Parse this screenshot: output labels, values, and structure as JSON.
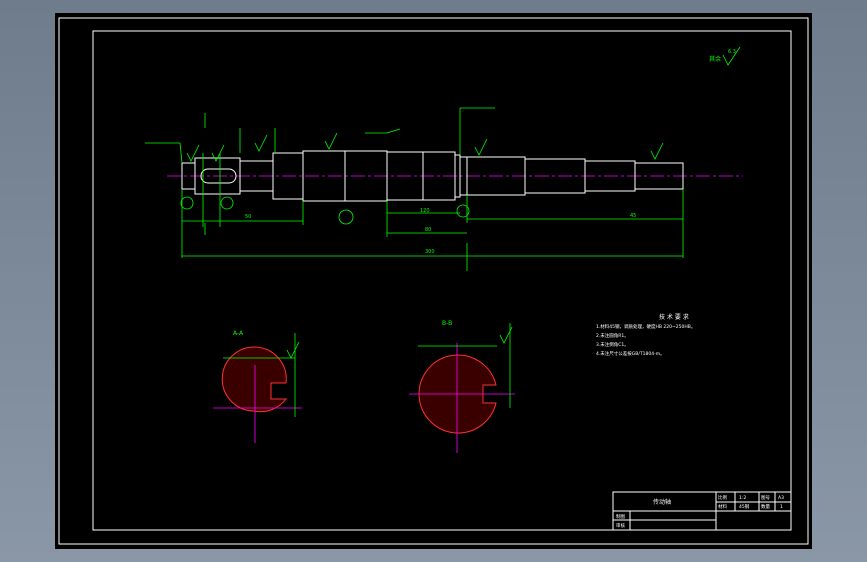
{
  "colors": {
    "background": "#000000",
    "outline": "#ffffff",
    "dimension": "#00ff00",
    "centerline": "#ff00ff",
    "hatch": "#ff0000"
  },
  "drawing": {
    "roughness_top_right": "其余",
    "roughness_symbol_value": "6.3",
    "section_a_label": "A-A",
    "section_b_label": "B-B",
    "tech_requirements": {
      "title": "技 术 要 求",
      "lines": [
        "1.材料45钢，调质处理，硬度HB 220~250HB。",
        "2.未注圆角R1。",
        "3.未注倒角C1。",
        "4.未注尺寸公差按GB/T1804-m。"
      ]
    },
    "dims": {
      "overall_length": "300",
      "d1": "50",
      "d2": "120",
      "d3": "80",
      "d4": "45"
    }
  },
  "title_block": {
    "part_name": "传动轴",
    "scale_label": "比例",
    "scale_value": "1:2",
    "sheet_label": "图号",
    "sheet_value": "A3",
    "material_label": "材料",
    "material_value": "45钢",
    "qty_label": "数量",
    "qty_value": "1",
    "drawn_label": "制图",
    "checked_label": "审核"
  }
}
